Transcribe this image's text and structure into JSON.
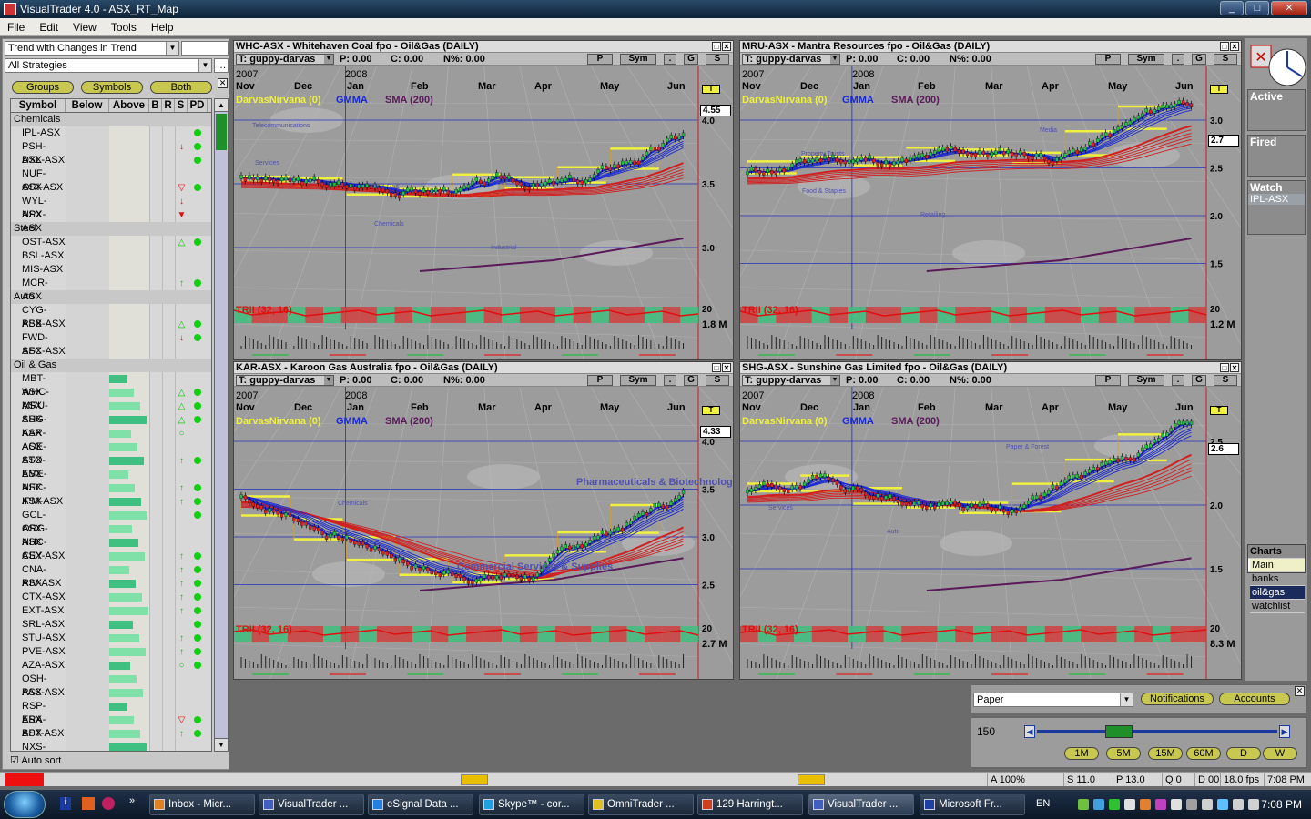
{
  "window": {
    "title": "VisualTrader 4.0 - ASX_RT_Map",
    "controls": [
      "_",
      "□",
      "✕"
    ]
  },
  "menu": [
    "File",
    "Edit",
    "View",
    "Tools",
    "Help"
  ],
  "left": {
    "combo1": "Trend with Changes in Trend",
    "combo2": "All Strategies",
    "buttons": {
      "groups": "Groups",
      "symbols": "Symbols",
      "both": "Both"
    },
    "headers": {
      "symbol": "Symbol",
      "below": "Below",
      "above": "Above",
      "b": "B",
      "r": "R",
      "s": "S",
      "pd": "PD"
    },
    "groups": [
      {
        "name": "Chemicals",
        "rows": [
          {
            "sym": "IPL-ASX",
            "ab": 0,
            "flag": "",
            "pd": "g"
          },
          {
            "sym": "PSH-ASX",
            "ab": 0,
            "flag": "dr",
            "pd": "g"
          },
          {
            "sym": "DXL-ASX",
            "ab": 0,
            "flag": "",
            "pd": "g"
          },
          {
            "sym": "NUF-ASX",
            "ab": 0,
            "flag": "",
            "pd": ""
          },
          {
            "sym": "ORI-ASX",
            "ab": 0,
            "flag": "tr",
            "pd": "g"
          },
          {
            "sym": "WYL-ASX",
            "ab": 0,
            "flag": "dr",
            "pd": ""
          },
          {
            "sym": "NPX-ASX",
            "ab": 0,
            "flag": "Tr",
            "pd": ""
          }
        ]
      },
      {
        "name": "Steel",
        "rows": [
          {
            "sym": "OST-ASX",
            "ab": 0,
            "flag": "ug",
            "pd": "g"
          },
          {
            "sym": "BSL-ASX",
            "ab": 0,
            "flag": "",
            "pd": ""
          },
          {
            "sym": "MIS-ASX",
            "ab": 0,
            "flag": "",
            "pd": ""
          },
          {
            "sym": "MCR-ASX",
            "ab": 0,
            "flag": "g",
            "pd": "g"
          }
        ]
      },
      {
        "name": "Auto",
        "rows": [
          {
            "sym": "CYG-ASX",
            "ab": 0,
            "flag": "",
            "pd": ""
          },
          {
            "sym": "PBB-ASX",
            "ab": 0,
            "flag": "ug",
            "pd": "g"
          },
          {
            "sym": "FWD-ASX",
            "ab": 0,
            "flag": "dr",
            "pd": "g"
          },
          {
            "sym": "SFC-ASX",
            "ab": 0,
            "flag": "",
            "pd": ""
          }
        ]
      },
      {
        "name": "Oil & Gas",
        "rows": [
          {
            "sym": "MBT-ASX",
            "ab": 1,
            "flag": "",
            "pd": ""
          },
          {
            "sym": "WHC-ASX",
            "ab": 1,
            "flag": "ug",
            "pd": "g"
          },
          {
            "sym": "MRU-ASX",
            "ab": 1,
            "flag": "ug",
            "pd": "g"
          },
          {
            "sym": "SHG-ASX",
            "ab": 1,
            "flag": "ug",
            "pd": "g"
          },
          {
            "sym": "KAR-ASX",
            "ab": 1,
            "flag": "o",
            "pd": ""
          },
          {
            "sym": "AOE-ASX",
            "ab": 1,
            "flag": "",
            "pd": ""
          },
          {
            "sym": "STO-ASX",
            "ab": 1,
            "flag": "g",
            "pd": "g"
          },
          {
            "sym": "EME-ASX",
            "ab": 1,
            "flag": "",
            "pd": ""
          },
          {
            "sym": "NEC-ASX",
            "ab": 1,
            "flag": "g",
            "pd": "g"
          },
          {
            "sym": "IPM-ASX",
            "ab": 1,
            "flag": "g",
            "pd": "g"
          },
          {
            "sym": "GCL-ASX",
            "ab": 1,
            "flag": "",
            "pd": "g"
          },
          {
            "sym": "ORG-ASX",
            "ab": 1,
            "flag": "",
            "pd": ""
          },
          {
            "sym": "NHC-ASX",
            "ab": 1,
            "flag": "",
            "pd": ""
          },
          {
            "sym": "CEY-ASX",
            "ab": 1,
            "flag": "g",
            "pd": "g"
          },
          {
            "sym": "CNA-ASX",
            "ab": 1,
            "flag": "g",
            "pd": "g"
          },
          {
            "sym": "RIV-ASX",
            "ab": 1,
            "flag": "g",
            "pd": "g"
          },
          {
            "sym": "CTX-ASX",
            "ab": 1,
            "flag": "g",
            "pd": "g"
          },
          {
            "sym": "EXT-ASX",
            "ab": 1,
            "flag": "g",
            "pd": "g"
          },
          {
            "sym": "SRL-ASX",
            "ab": 1,
            "flag": "",
            "pd": "g"
          },
          {
            "sym": "STU-ASX",
            "ab": 1,
            "flag": "g",
            "pd": "g"
          },
          {
            "sym": "PVE-ASX",
            "ab": 1,
            "flag": "g",
            "pd": "g"
          },
          {
            "sym": "AZA-ASX",
            "ab": 1,
            "flag": "o",
            "pd": "g"
          },
          {
            "sym": "OSH-ASX",
            "ab": 1,
            "flag": "",
            "pd": ""
          },
          {
            "sym": "PAS-ASX",
            "ab": 1,
            "flag": "",
            "pd": ""
          },
          {
            "sym": "RSP-ASX",
            "ab": 1,
            "flag": "",
            "pd": ""
          },
          {
            "sym": "ERA-ASX",
            "ab": 1,
            "flag": "tr",
            "pd": "g"
          },
          {
            "sym": "BPT-ASX",
            "ab": 1,
            "flag": "g",
            "pd": "g"
          },
          {
            "sym": "NXS-ASX",
            "ab": 1,
            "flag": "",
            "pd": ""
          }
        ]
      }
    ],
    "autosort": "Auto sort"
  },
  "charts": [
    {
      "title": "WHC-ASX - Whitehaven Coal fpo - Oil&Gas (DAILY)",
      "template": "T: guppy-darvas",
      "p": "P: 0.00",
      "c": "C: 0.00",
      "n": "N%: 0.00",
      "years": [
        "2007",
        "2008"
      ],
      "months": [
        "Nov",
        "Dec",
        "Jan",
        "Feb",
        "Mar",
        "Apr",
        "May",
        "Jun"
      ],
      "ind": [
        "DarvasNirvana (0)",
        "GMMA",
        "SMA (200)"
      ],
      "last": "4.55",
      "yticks": [
        "4.0",
        "3.5",
        "3.0"
      ],
      "trii": "TRII (32, 16)",
      "trii_val": "20",
      "vol": "1.8 M",
      "labels": [
        "Telecommunications",
        "Oil & Gas",
        "Industrial",
        "Services",
        "Chemicals"
      ]
    },
    {
      "title": "MRU-ASX - Mantra Resources fpo - Oil&Gas (DAILY)",
      "template": "T: guppy-darvas",
      "p": "P: 0.00",
      "c": "C: 0.00",
      "n": "N%: 0.00",
      "years": [
        "2007",
        "2008"
      ],
      "months": [
        "Nov",
        "Dec",
        "Jan",
        "Feb",
        "Mar",
        "Apr",
        "May",
        "Jun"
      ],
      "ind": [
        "DarvasNirvana (0)",
        "GMMA",
        "SMA (200)"
      ],
      "last": "2.7",
      "yticks": [
        "3.0",
        "2.5",
        "2.0",
        "1.5"
      ],
      "trii": "TRII (32, 16)",
      "trii_val": "20",
      "vol": "1.2 M",
      "labels": [
        "Property Trusts",
        "Retailing",
        "Media",
        "Food & Staples"
      ]
    },
    {
      "title": "KAR-ASX - Karoon Gas Australia fpo - Oil&Gas (DAILY)",
      "template": "T: guppy-darvas",
      "p": "P: 0.00",
      "c": "C: 0.00",
      "n": "N%: 0.00",
      "years": [
        "2007",
        "2008"
      ],
      "months": [
        "Nov",
        "Dec",
        "Jan",
        "Feb",
        "Mar",
        "Apr",
        "May",
        "Jun"
      ],
      "ind": [
        "DarvasNirvana (0)",
        "GMMA",
        "SMA (200)"
      ],
      "last": "4.33",
      "yticks": [
        "4.0",
        "3.5",
        "3.0",
        "2.5"
      ],
      "trii": "TRII (32, 16)",
      "trii_val": "20",
      "vol": "2.7 M",
      "labels": [
        "Chemicals",
        "Commercial Services & Supplies",
        "Pharmaceuticals & Biotechnology"
      ]
    },
    {
      "title": "SHG-ASX - Sunshine Gas Limited fpo - Oil&Gas (DAILY)",
      "template": "T: guppy-darvas",
      "p": "P: 0.00",
      "c": "C: 0.00",
      "n": "N%: 0.00",
      "years": [
        "2007",
        "2008"
      ],
      "months": [
        "Nov",
        "Dec",
        "Jan",
        "Feb",
        "Mar",
        "Apr",
        "May",
        "Jun"
      ],
      "ind": [
        "DarvasNirvana (0)",
        "GMMA",
        "SMA (200)"
      ],
      "last": "2.6",
      "yticks": [
        "2.5",
        "2.0",
        "1.5"
      ],
      "trii": "TRII (32, 16)",
      "trii_val": "20",
      "vol": "8.3 M",
      "labels": [
        "Auto",
        "Paper & Forest",
        "Services"
      ]
    }
  ],
  "chart_buttons": {
    "p": "P",
    "sym": "Sym",
    "dot": ".",
    "g": "G",
    "s": "S",
    "t": "T"
  },
  "right": {
    "active": "Active",
    "fired": "Fired",
    "watch": "Watch",
    "watch_item": "IPL-ASX",
    "charts_header": "Charts",
    "charts": [
      "Main",
      "banks",
      "oil&gas",
      "watchlist"
    ],
    "charts_selected": 2
  },
  "paper": {
    "combo": "Paper",
    "notifications": "Notifications",
    "accounts": "Accounts"
  },
  "slider": {
    "value": "150",
    "level": 0.32,
    "tf": [
      "1M",
      "5M",
      "15M",
      "60M",
      "D",
      "W"
    ]
  },
  "status": {
    "zoom": "A 100%",
    "s": "S 11.0 ms",
    "p": "P 13.0 ms",
    "q": "Q 0",
    "d": "D 00",
    "fps": "18.0 fps",
    "time": "7:08 PM"
  },
  "taskbar": {
    "tasks": [
      "Inbox - Micr...",
      "VisualTrader ...",
      "eSignal Data ...",
      "Skype™ - cor...",
      "OmniTrader ...",
      "129 Harringt...",
      "VisualTrader ...",
      "Microsoft Fr..."
    ],
    "active": 6,
    "lang": "EN",
    "clock": "7:08 PM"
  },
  "colors": {
    "gmma_short": "#1a2ad0",
    "gmma_long": "#d02020",
    "darvas": "#f0f040",
    "sma": "#5a1a5a",
    "trii_green": "#3fc080",
    "trii_red": "#d04040"
  }
}
